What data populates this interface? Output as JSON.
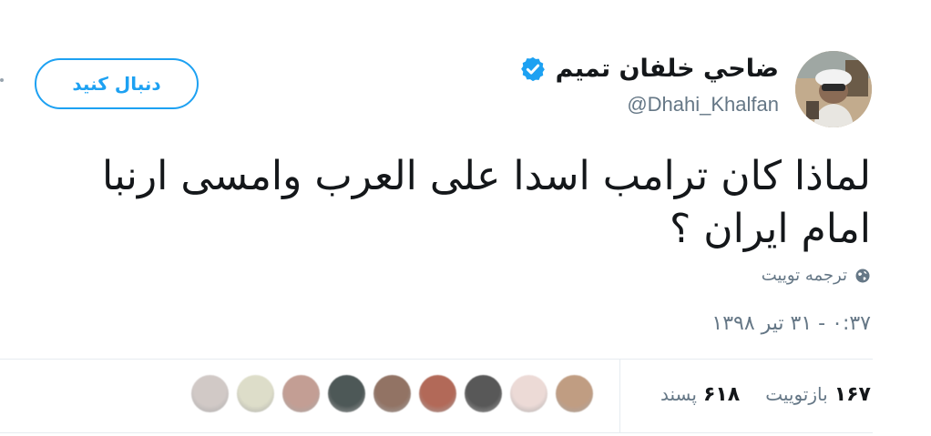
{
  "user": {
    "display_name": "ضاحي خلفان تميم",
    "handle": "@Dhahi_Khalfan",
    "verified": true
  },
  "follow_button": {
    "label": "دنبال کنید"
  },
  "tweet": {
    "text": "لماذا كان ترامب اسدا على العرب وامسى ارنبا امام ايران ؟",
    "translate_label": "ترجمه توییت",
    "timestamp": "۰:۳۷ - ۳۱ تیر ۱۳۹۸"
  },
  "stats": {
    "retweets_count": "۱۶۷",
    "retweets_label": "بازتوییت",
    "likes_count": "۶۱۸",
    "likes_label": "پسند"
  },
  "likers": [
    {
      "color": "#c9c0bd"
    },
    {
      "color": "#d8d8c0"
    },
    {
      "color": "#b98e82"
    },
    {
      "color": "#2f3b3a"
    },
    {
      "color": "#7f5b4a"
    },
    {
      "color": "#a5503c"
    },
    {
      "color": "#3b3b3b"
    },
    {
      "color": "#e9d4d0"
    },
    {
      "color": "#b68c6d"
    }
  ],
  "colors": {
    "accent": "#1da1f2",
    "text_primary": "#14171a",
    "text_secondary": "#657786"
  },
  "icons": [
    "verified-badge-icon",
    "globe-icon",
    "avatar-image"
  ]
}
